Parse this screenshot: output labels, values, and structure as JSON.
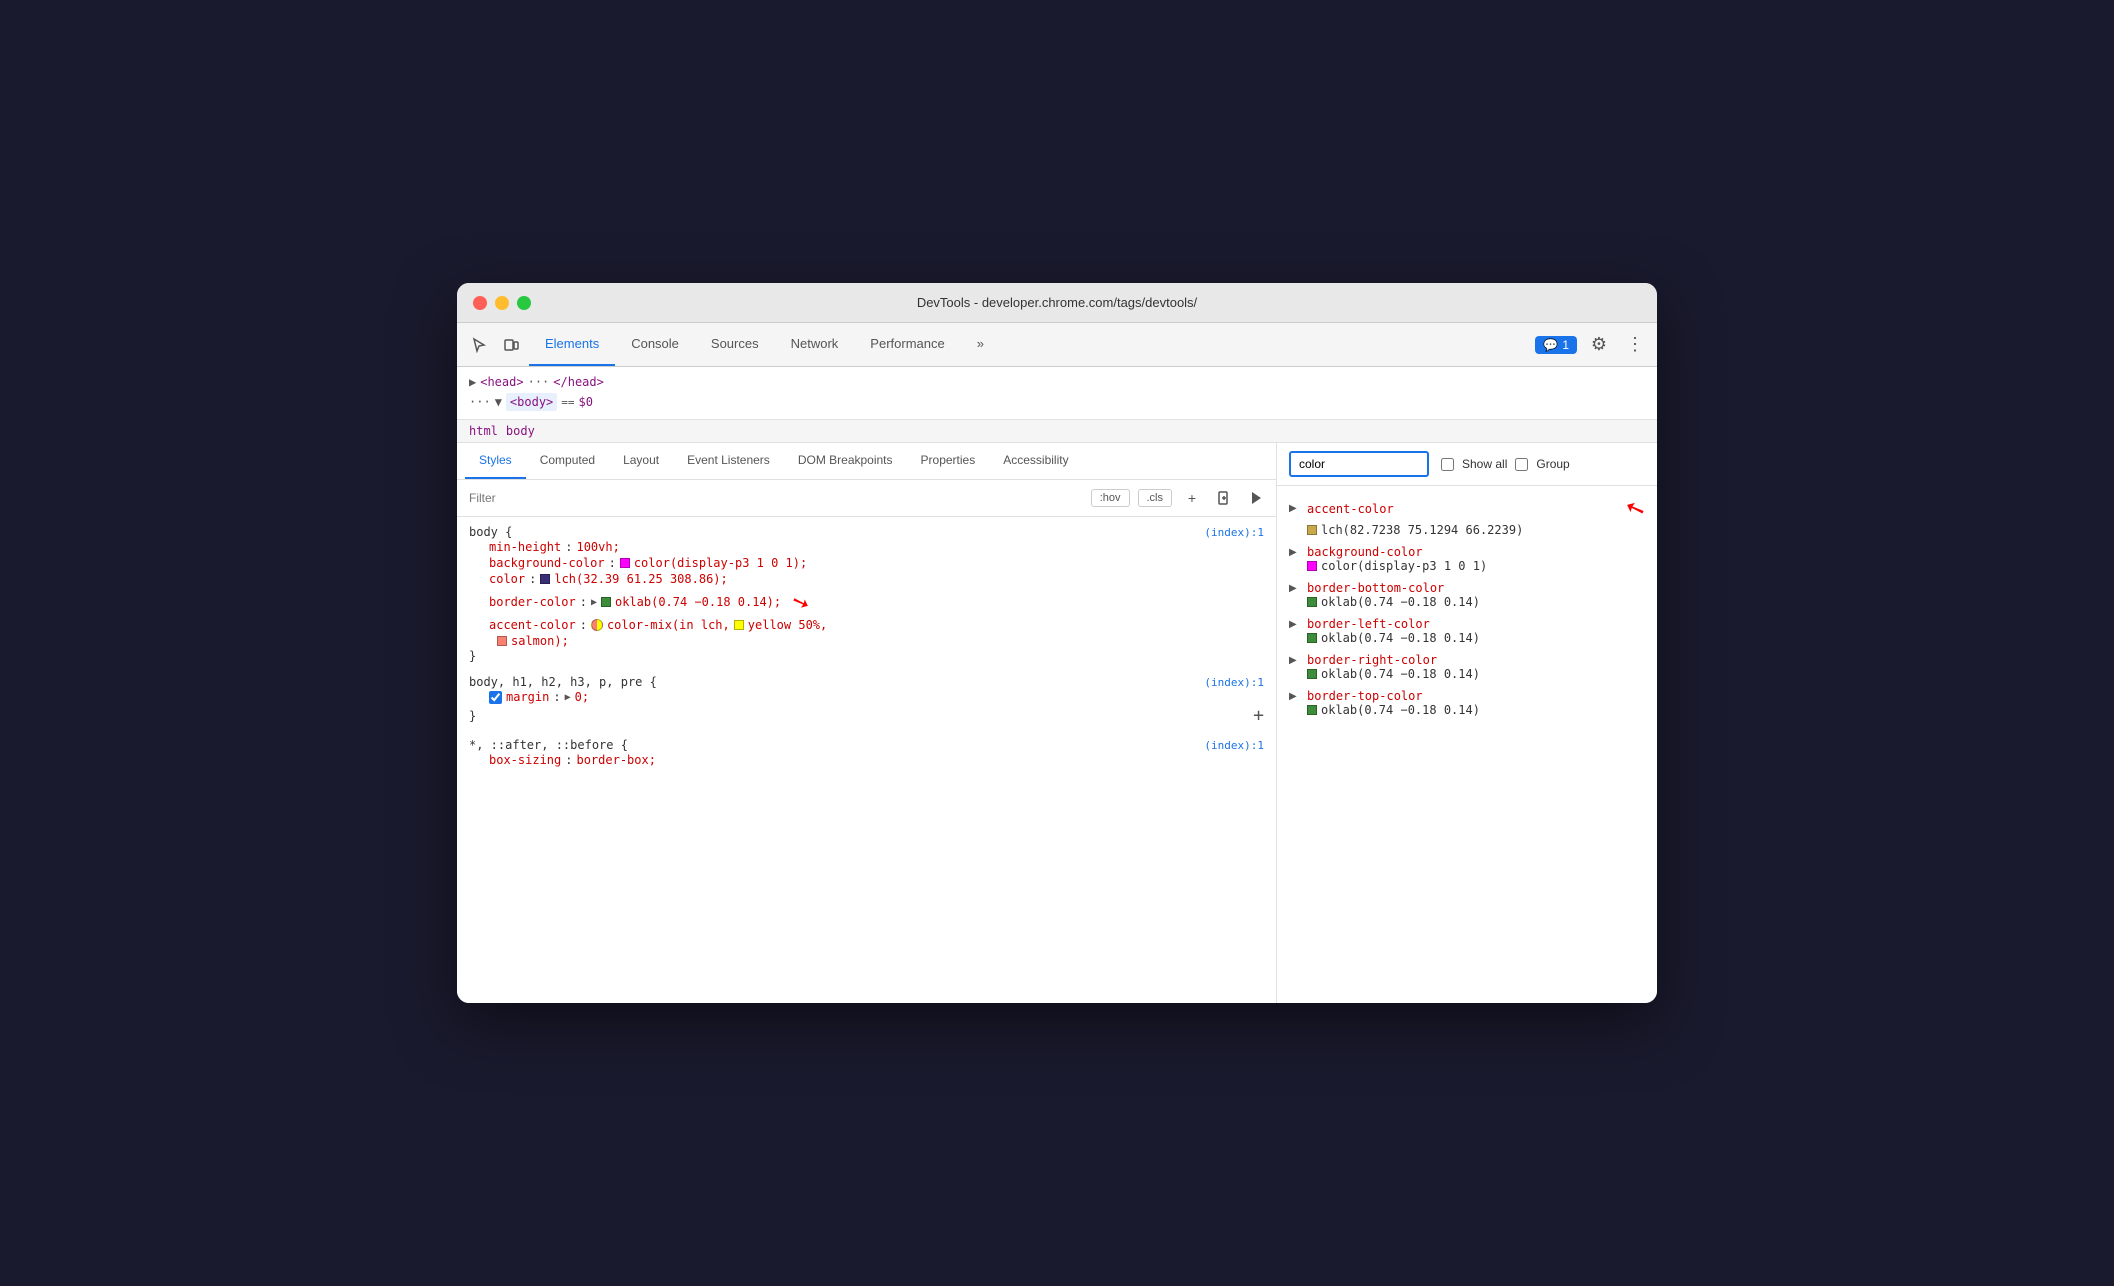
{
  "window": {
    "title": "DevTools - developer.chrome.com/tags/devtools/",
    "traffic_lights": [
      "red",
      "yellow",
      "green"
    ]
  },
  "toolbar": {
    "tabs": [
      {
        "label": "Elements",
        "active": true
      },
      {
        "label": "Console",
        "active": false
      },
      {
        "label": "Sources",
        "active": false
      },
      {
        "label": "Network",
        "active": false
      },
      {
        "label": "Performance",
        "active": false
      },
      {
        "label": "»",
        "active": false
      }
    ],
    "notification_count": "1",
    "more_tools_label": "»"
  },
  "dom": {
    "head_line": "<head> ··· </head>",
    "body_line": "··· ▼ <body> == $0"
  },
  "breadcrumb": {
    "items": [
      "html",
      "body"
    ]
  },
  "sub_tabs": [
    {
      "label": "Styles",
      "active": true
    },
    {
      "label": "Computed",
      "active": false
    },
    {
      "label": "Layout",
      "active": false
    },
    {
      "label": "Event Listeners",
      "active": false
    },
    {
      "label": "DOM Breakpoints",
      "active": false
    },
    {
      "label": "Properties",
      "active": false
    },
    {
      "label": "Accessibility",
      "active": false
    }
  ],
  "filter": {
    "placeholder": "Filter",
    "hov_label": ":hov",
    "cls_label": ".cls"
  },
  "css_rules": [
    {
      "selector": "body {",
      "source": "(index):1",
      "properties": [
        {
          "name": "min-height",
          "colon": ":",
          "value": "100vh;",
          "type": "text"
        },
        {
          "name": "background-color",
          "colon": ":",
          "swatch_color": "#ff00ff",
          "value": "color(display-p3 1 0 1);",
          "type": "color"
        },
        {
          "name": "color",
          "colon": ":",
          "swatch_color": "#382f77",
          "value": "lch(32.39 61.25 308.86);",
          "type": "color"
        },
        {
          "name": "border-color",
          "colon": ":",
          "swatch_color": "#3d8c3a",
          "value": "oklab(0.74 −0.18 0.14);",
          "type": "color_arrow"
        },
        {
          "name": "accent-color",
          "colon": ":",
          "value": "color-mix(in lch, yellow 50%, salmon);",
          "type": "color_mix"
        }
      ],
      "close": "}"
    },
    {
      "selector": "body, h1, h2, h3, p, pre {",
      "source": "(index):1",
      "properties": [
        {
          "name": "margin",
          "colon": ":",
          "value": "▶ 0;",
          "type": "checkbox",
          "checked": true
        }
      ],
      "close": "}"
    },
    {
      "selector": "*, ::after, ::before {",
      "source": "(index):1",
      "properties": [
        {
          "name": "box-sizing",
          "colon": ":",
          "value": "border-box;",
          "type": "text"
        }
      ],
      "close": ""
    }
  ],
  "computed_panel": {
    "search_value": "color",
    "show_all_label": "Show all",
    "group_label": "Group",
    "items": [
      {
        "name": "accent-color",
        "swatch_color": "#c8a84b",
        "value": "lch(82.7238 75.1294 66.2239)",
        "has_arrow": true
      },
      {
        "name": "background-color",
        "swatch_color": "#ff00ff",
        "value": "color(display-p3 1 0 1)",
        "has_arrow": false
      },
      {
        "name": "border-bottom-color",
        "swatch_color": "#3d8c3a",
        "value": "oklab(0.74 −0.18 0.14)",
        "has_arrow": false
      },
      {
        "name": "border-left-color",
        "swatch_color": "#3d8c3a",
        "value": "oklab(0.74 −0.18 0.14)",
        "has_arrow": false
      },
      {
        "name": "border-right-color",
        "swatch_color": "#3d8c3a",
        "value": "oklab(0.74 −0.18 0.14)",
        "has_arrow": false
      },
      {
        "name": "border-top-color",
        "swatch_color": "#3d8c3a",
        "value": "oklab(0.74 −0.18 0.14)",
        "has_arrow": false
      }
    ]
  }
}
